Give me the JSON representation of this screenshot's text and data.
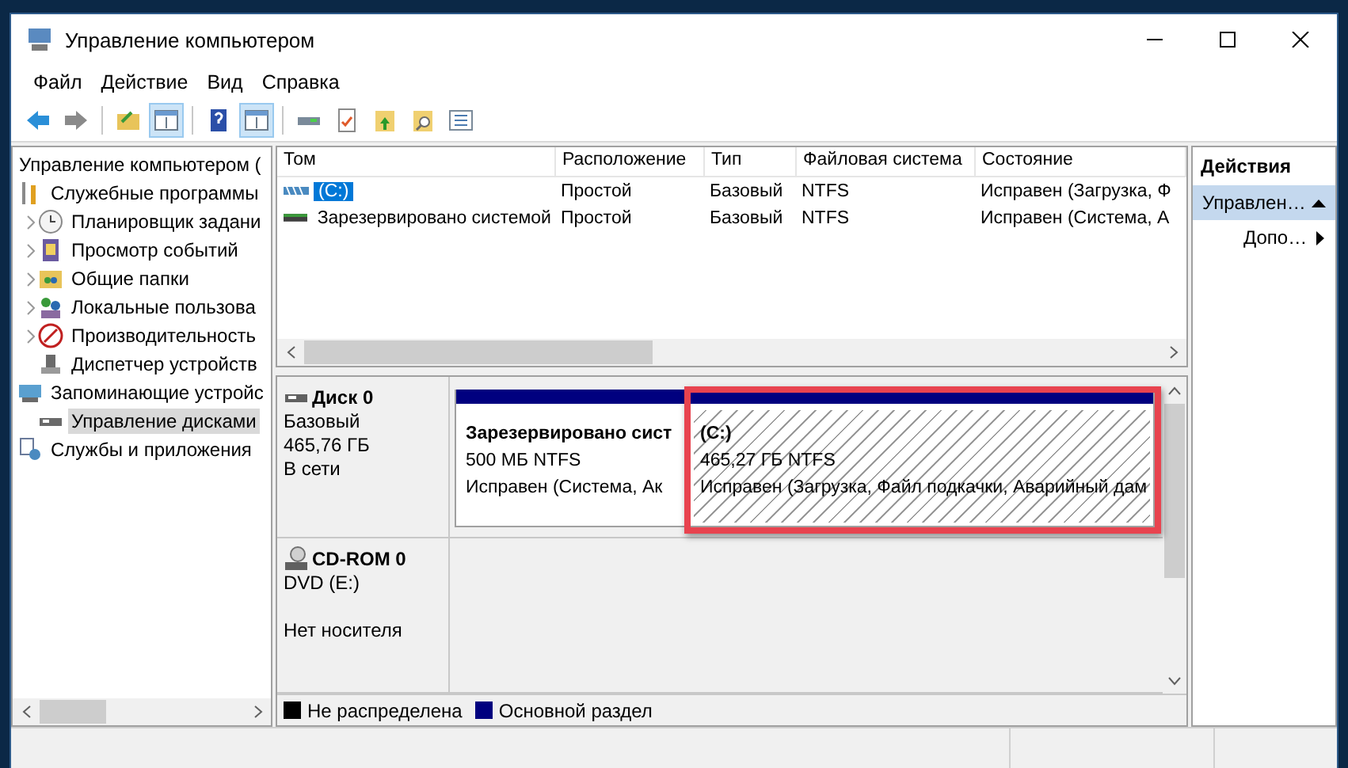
{
  "window": {
    "title": "Управление компьютером"
  },
  "menu": [
    "Файл",
    "Действие",
    "Вид",
    "Справка"
  ],
  "toolbar": [
    {
      "kind": "back",
      "pressed": false
    },
    {
      "kind": "forward",
      "pressed": false
    },
    {
      "kind": "sep"
    },
    {
      "kind": "folder-up",
      "pressed": false
    },
    {
      "kind": "pane",
      "pressed": true
    },
    {
      "kind": "sep"
    },
    {
      "kind": "help",
      "pressed": false
    },
    {
      "kind": "pane",
      "pressed": true
    },
    {
      "kind": "sep"
    },
    {
      "kind": "drive",
      "pressed": false
    },
    {
      "kind": "check",
      "pressed": false
    },
    {
      "kind": "up",
      "pressed": false
    },
    {
      "kind": "find",
      "pressed": false
    },
    {
      "kind": "list",
      "pressed": false
    }
  ],
  "tree": {
    "label": "Управление компьютером (",
    "selected": false,
    "children": [
      {
        "label": "Служебные программы",
        "selected": false,
        "children": [
          {
            "label": "Планировщик задани",
            "selected": false,
            "collapsed": true
          },
          {
            "label": "Просмотр событий",
            "selected": false,
            "collapsed": true
          },
          {
            "label": "Общие папки",
            "selected": false,
            "collapsed": true
          },
          {
            "label": "Локальные пользова",
            "selected": false,
            "collapsed": true
          },
          {
            "label": "Производительность",
            "selected": false,
            "collapsed": true
          },
          {
            "label": "Диспетчер устройств",
            "selected": false,
            "collapsed": false
          }
        ]
      },
      {
        "label": "Запоминающие устройс",
        "selected": false,
        "children": [
          {
            "label": "Управление дисками",
            "selected": true,
            "collapsed": false
          }
        ]
      },
      {
        "label": "Службы и приложения",
        "selected": false
      }
    ]
  },
  "volumes": {
    "columns": [
      "Том",
      "Расположение",
      "Тип",
      "Файловая система",
      "Состояние"
    ],
    "rows": [
      {
        "cells": [
          "(C:)",
          "Простой",
          "Базовый",
          "NTFS",
          "Исправен (Загрузка, Ф"
        ],
        "selected": true
      },
      {
        "cells": [
          "Зарезервировано системой",
          "Простой",
          "Базовый",
          "NTFS",
          "Исправен (Система, А"
        ],
        "selected": false
      }
    ]
  },
  "disks": [
    {
      "name": "Диск 0",
      "kind": "hdd",
      "lines": [
        "Базовый",
        "465,76 ГБ",
        "В сети"
      ],
      "partitions": [
        {
          "title": "Зарезервировано сист",
          "size": "500 МБ NTFS",
          "status": "Исправен (Система, Ак",
          "kind": "primary",
          "selected": false,
          "highlighted": false
        },
        {
          "title": "(C:)",
          "size": "465,27 ГБ NTFS",
          "status": "Исправен (Загрузка, Файл подкачки, Аварийный дам",
          "kind": "primary",
          "selected": true,
          "highlighted": true
        }
      ]
    },
    {
      "name": "CD-ROM 0",
      "kind": "cdrom",
      "lines": [
        "DVD (E:)",
        "Нет носителя"
      ]
    }
  ],
  "legend": [
    {
      "label": "Не распределена",
      "color": "#000000"
    },
    {
      "label": "Основной раздел",
      "color": "#00007f"
    }
  ],
  "actions": {
    "title": "Действия",
    "items": [
      {
        "label": "Управлен…",
        "kind": "section"
      },
      {
        "label": "Допо…",
        "kind": "item"
      }
    ]
  }
}
